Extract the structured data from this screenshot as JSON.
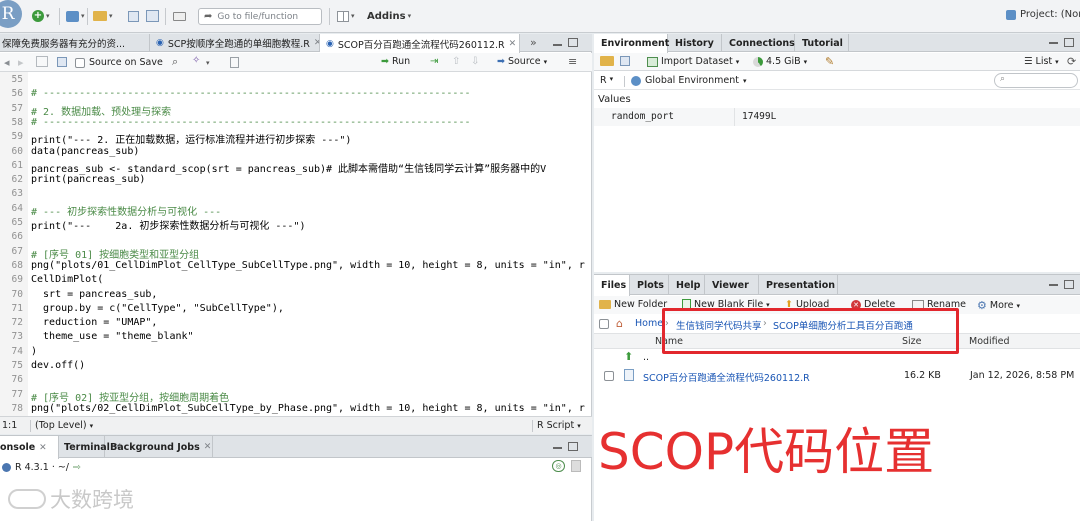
{
  "toolbar": {
    "logo": "R",
    "goto_placeholder": "Go to file/function",
    "addins_label": "Addins",
    "project_label": "Project: (Nor"
  },
  "editor": {
    "tabs": [
      {
        "label": "保障免费服务器有充分的资..."
      },
      {
        "label": "SCP按顺序全跑通的单细胞教程.R"
      },
      {
        "label": "SCOP百分百跑通全流程代码260112.R"
      }
    ],
    "source_on_save": "Source on Save",
    "run_label": "Run",
    "source_label": "Source",
    "lines": [
      {
        "num": "55",
        "text": ""
      },
      {
        "num": "56",
        "text": "# -----------------------------------------------------------------------"
      },
      {
        "num": "57",
        "text": "# 2. 数据加载、预处理与探索"
      },
      {
        "num": "58",
        "text": "# -----------------------------------------------------------------------"
      },
      {
        "num": "59",
        "text": "print(\"--- 2. 正在加载数据，运行标准流程并进行初步探索 ---\")"
      },
      {
        "num": "60",
        "text": "data(pancreas_sub)"
      },
      {
        "num": "61",
        "text": "pancreas_sub <- standard_scop(srt = pancreas_sub)# 此脚本需借助“生信钱同学云计算”服务器中的V"
      },
      {
        "num": "62",
        "text": "print(pancreas_sub)"
      },
      {
        "num": "63",
        "text": ""
      },
      {
        "num": "64",
        "text": "# --- 初步探索性数据分析与可视化 ---"
      },
      {
        "num": "65",
        "text": "print(\"---    2a. 初步探索性数据分析与可视化 ---\")"
      },
      {
        "num": "66",
        "text": ""
      },
      {
        "num": "67",
        "text": "# [序号 01] 按细胞类型和亚型分组"
      },
      {
        "num": "68",
        "text": "png(\"plots/01_CellDimPlot_CellType_SubCellType.png\", width = 10, height = 8, units = \"in\", r"
      },
      {
        "num": "69",
        "text": "CellDimPlot("
      },
      {
        "num": "70",
        "text": "  srt = pancreas_sub,"
      },
      {
        "num": "71",
        "text": "  group.by = c(\"CellType\", \"SubCellType\"),"
      },
      {
        "num": "72",
        "text": "  reduction = \"UMAP\","
      },
      {
        "num": "73",
        "text": "  theme_use = \"theme_blank\""
      },
      {
        "num": "74",
        "text": ")"
      },
      {
        "num": "75",
        "text": "dev.off()"
      },
      {
        "num": "76",
        "text": ""
      },
      {
        "num": "77",
        "text": "# [序号 02] 按亚型分组，按细胞周期着色"
      },
      {
        "num": "78",
        "text": "png(\"plots/02_CellDimPlot_SubCellType_by_Phase.png\", width = 10, height = 8, units = \"in\", r"
      },
      {
        "num": "79",
        "text": "CellDimPlot("
      }
    ],
    "status_pos": "1:1",
    "status_scope": "(Top Level)",
    "status_type": "R Script"
  },
  "console": {
    "tabs": [
      {
        "label": "onsole"
      },
      {
        "label": "Terminal"
      },
      {
        "label": "Background Jobs"
      }
    ],
    "version": "R 4.3.1 · ~/"
  },
  "env": {
    "tabs": [
      {
        "label": "Environment"
      },
      {
        "label": "History"
      },
      {
        "label": "Connections"
      },
      {
        "label": "Tutorial"
      }
    ],
    "import_label": "Import Dataset",
    "memory_label": "4.5 GiB",
    "list_label": "List",
    "lang_label": "R",
    "scope_label": "Global Environment",
    "values_heading": "Values",
    "values": [
      {
        "name": "random_port",
        "value": "17499L"
      }
    ]
  },
  "files": {
    "tabs": [
      {
        "label": "Files"
      },
      {
        "label": "Plots"
      },
      {
        "label": "Help"
      },
      {
        "label": "Viewer"
      },
      {
        "label": "Presentation"
      }
    ],
    "new_folder": "New Folder",
    "new_blank": "New Blank File",
    "upload": "Upload",
    "delete": "Delete",
    "rename": "Rename",
    "more": "More",
    "breadcrumb": [
      "Home",
      "生信钱同学代码共享",
      "SCOP单细胞分析工具百分百跑通"
    ],
    "columns": {
      "name": "Name",
      "size": "Size",
      "modified": "Modified"
    },
    "up_label": "..",
    "rows": [
      {
        "name": "SCOP百分百跑通全流程代码260112.R",
        "size": "16.2 KB",
        "modified": "Jan 12, 2026, 8:58 PM"
      }
    ]
  },
  "annotation": {
    "note": "SCOP代码位置",
    "watermark": "大数跨境"
  },
  "colors": {
    "accent_red": "#e2272d",
    "link_blue": "#1a56b5",
    "comment_green": "#4a8a46"
  }
}
